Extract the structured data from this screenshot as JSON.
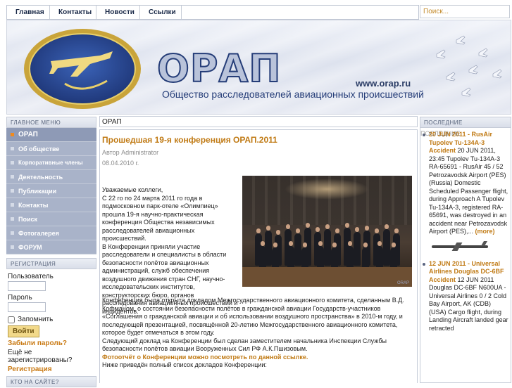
{
  "nav": {
    "items": [
      {
        "label": "Главная"
      },
      {
        "label": "Контакты"
      },
      {
        "label": "Новости"
      },
      {
        "label": "Ссылки"
      }
    ],
    "search_placeholder": "Поиск..."
  },
  "banner": {
    "brand": "ОРАП",
    "url": "www.orap.ru",
    "subtitle": "Общество расследователей авиационных происшествий"
  },
  "sidebar": {
    "main_menu_title": "ГЛАВНОЕ МЕНЮ",
    "items": [
      {
        "label": "ОРАП",
        "active": true
      },
      {
        "label": "Об обществе"
      },
      {
        "label": "Корпоративные члены"
      },
      {
        "label": "Деятельность"
      },
      {
        "label": "Публикации"
      },
      {
        "label": "Контакты"
      },
      {
        "label": "Поиск"
      },
      {
        "label": "Фотогалерея"
      },
      {
        "label": "ФОРУМ"
      }
    ],
    "registration_title": "РЕГИСТРАЦИЯ",
    "user_label": "Пользователь",
    "password_label": "Пароль",
    "remember_label": "Запомнить",
    "login_button": "Войти",
    "forgot_link": "Забыли пароль?",
    "not_registered": "Ещё не зарегистрированы?",
    "register_link": "Регистрация",
    "whos_online_title": "КТО НА САЙТЕ?"
  },
  "main": {
    "breadcrumb": "ОРАП",
    "title": "Прошедшая 19-я конференция ОРАП.2011",
    "author": "Автор Administrator",
    "date": "08.04.2010 г.",
    "photo_tag": "ORAP",
    "left_text": [
      "Уважаемые коллеги,",
      "С 22 го по 24 марта 2011 го года в подмосковном парк-отеле «Олимпиец» прошла 19-я научно-практическая конференция Общества независимых расследователей авиационных происшествий.",
      "В Конференции приняли участие расследователи и специалисты в области безопасности полётов авиационных администраций, служб обеспечения воздушного движения стран СНГ, научно-исследовательских институтов, конструкторских бюро, органов расследования авиационных происшествий и инцидентов."
    ],
    "full_text_1": "Конференция была открыта докладом Межгосударственного авиационного комитета, сделанным В.Д. Кофманом, о состоянии безопасности полётов в гражданской авиации Государств-участников «Соглашения о гражданской авиации и об использовании воздушного пространства» в 2010-м году, и последующей презентацией, посвящённой 20-летию Межгосударственного авиационного комитета, которое будет отмечаться в этом году.",
    "full_text_2": "Следующий доклад на Конференции был сделан заместителем начальника Инспекции Службы безопасности полётов авиации Вооруженных Сил РФ А.К.Пшизовым.",
    "photo_link": "Фотоотчёт о Конференции можно посмотреть по данной ссылке.",
    "full_text_3": "Ниже приведён полный список докладов Конференции:"
  },
  "right": {
    "title": "ПОСЛЕДНИЕ",
    "overlap_text": "ПОСЛЕДНИЕ",
    "news": [
      {
        "headline": "20 JUN 2011 - RusAir Tupolev Tu-134A-3 Accident",
        "text": "20 JUN 2011, 23:45 Tupolev Tu-134A-3 RA-65691 - RusAir 45 / 52 Petrozavodsk Airport (PES) (Russia) Domestic Scheduled Passenger flight, during Approach A Tupolev Tu-134A-3, registered RA-65691, was destroyed in an accident near Petrozavodsk Airport (PES),...",
        "more": "(more)"
      },
      {
        "headline": "12 JUN 2011 - Universal Airlines Douglas DC-6BF Accident",
        "text": "12 JUN 2011 Douglas DC-6BF N600UA - Universal Airlines 0 / 2 Cold Bay Airport, AK (CDB) (USA) Cargo flight, during Landing Aircraft landed gear retracted"
      }
    ]
  },
  "colors": {
    "accent": "#c07a14",
    "menu_bg": "#a9b3c9",
    "brand_blue": "#253d78"
  }
}
